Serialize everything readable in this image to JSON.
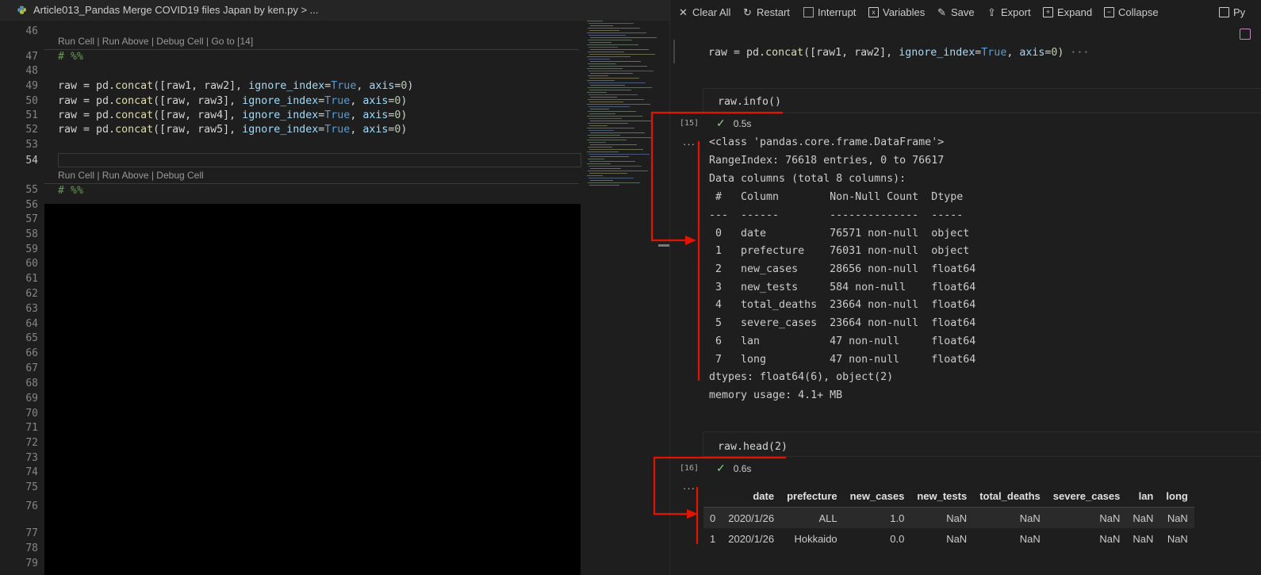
{
  "editor": {
    "breadcrumb": "Article013_Pandas Merge COVID19 files Japan by ken.py > ...",
    "codelens_1": "Run Cell | Run Above | Debug Cell | Go to [14]",
    "codelens_2": "Run Cell | Run Above | Debug Cell",
    "line_numbers": [
      "46",
      "47",
      "48",
      "49",
      "50",
      "51",
      "52",
      "53",
      "54",
      "55",
      "56",
      "57",
      "58",
      "59",
      "60",
      "61",
      "62",
      "63",
      "64",
      "65",
      "66",
      "67",
      "68",
      "69",
      "70",
      "71",
      "72",
      "73",
      "74",
      "75",
      "76",
      "77",
      "78",
      "79"
    ],
    "cell_marker": "# %%"
  },
  "toolbar": {
    "clear_all": "Clear All",
    "restart": "Restart",
    "interrupt": "Interrupt",
    "variables": "Variables",
    "save": "Save",
    "export": "Export",
    "expand": "Expand",
    "collapse": "Collapse",
    "kernel": "Py"
  },
  "cells": {
    "prev_input": "raw = pd.concat([raw1, raw2], ignore_index=True, axis=0)",
    "prev_ellipsis": "···",
    "info_input": "raw.info()",
    "info_count": "[15]",
    "info_time": "0.5s",
    "info_dots": "···",
    "info_output": [
      "<class 'pandas.core.frame.DataFrame'>",
      "RangeIndex: 76618 entries, 0 to 76617",
      "Data columns (total 8 columns):",
      " #   Column        Non-Null Count  Dtype  ",
      "---  ------        --------------  -----  ",
      " 0   date          76571 non-null  object ",
      " 1   prefecture    76031 non-null  object ",
      " 2   new_cases     28656 non-null  float64",
      " 3   new_tests     584 non-null    float64",
      " 4   total_deaths  23664 non-null  float64",
      " 5   severe_cases  23664 non-null  float64",
      " 6   lan           47 non-null     float64",
      " 7   long          47 non-null     float64",
      "dtypes: float64(6), object(2)",
      "memory usage: 4.1+ MB"
    ],
    "head_input": "raw.head(2)",
    "head_count": "[16]",
    "head_time": "0.6s",
    "head_dots": "···"
  },
  "dataframe": {
    "columns": [
      "",
      "date",
      "prefecture",
      "new_cases",
      "new_tests",
      "total_deaths",
      "severe_cases",
      "lan",
      "long"
    ],
    "rows": [
      [
        "0",
        "2020/1/26",
        "ALL",
        "1.0",
        "NaN",
        "NaN",
        "NaN",
        "NaN",
        "NaN"
      ],
      [
        "1",
        "2020/1/26",
        "Hokkaido",
        "0.0",
        "NaN",
        "NaN",
        "NaN",
        "NaN",
        "NaN"
      ]
    ]
  },
  "colors": {
    "annotation": "#e51400",
    "keyword": "#569cd6",
    "function": "#dcdcaa",
    "param": "#9cdcfe",
    "number": "#b5cea8",
    "comment": "#6a9955",
    "check": "#89d185"
  }
}
